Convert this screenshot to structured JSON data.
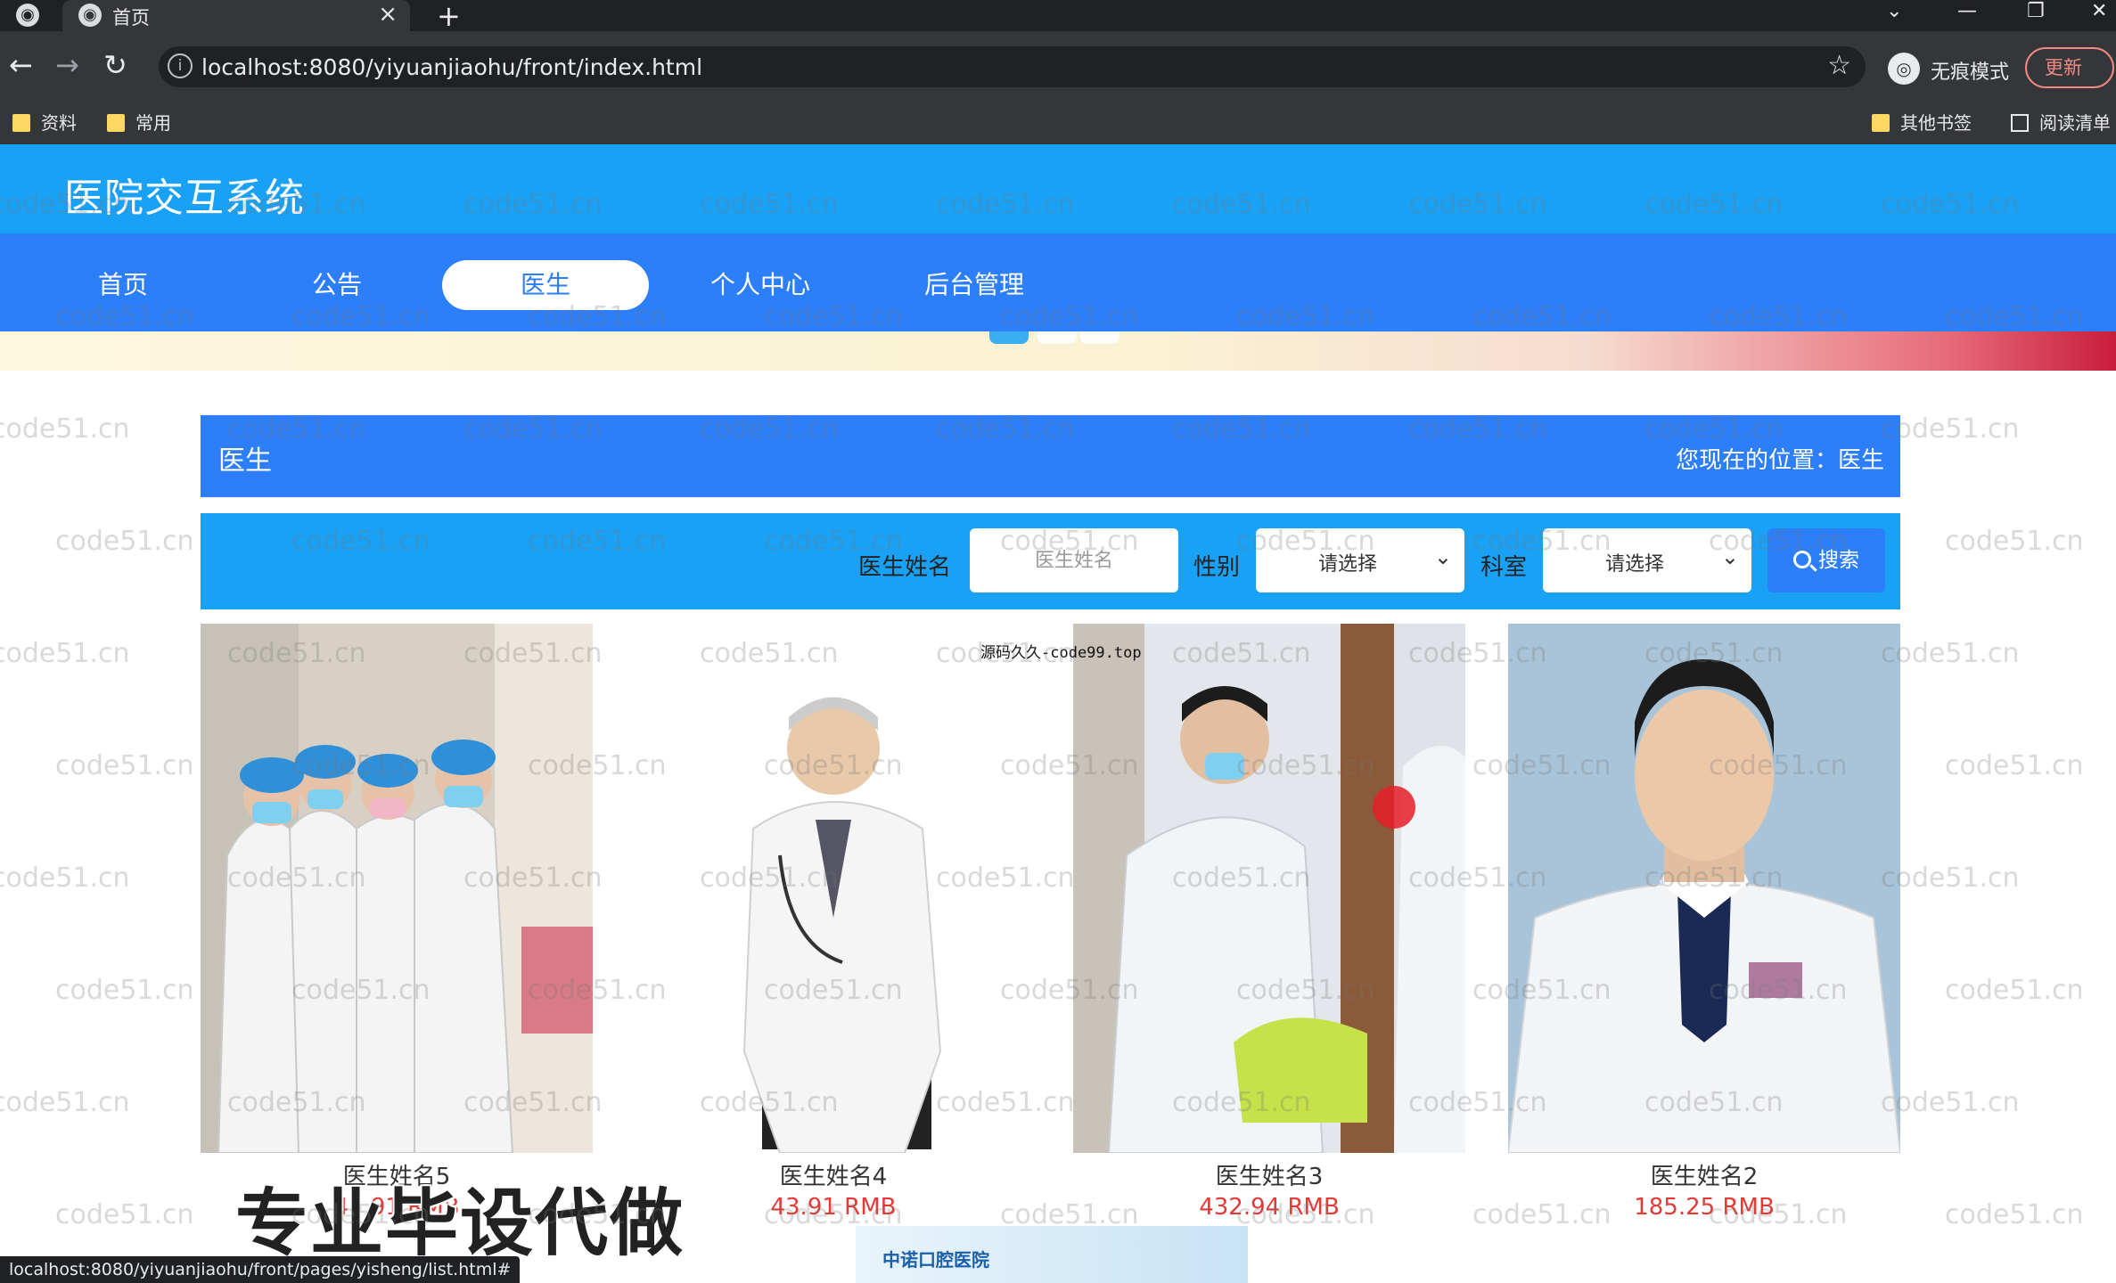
{
  "browser": {
    "tab_title": "首页",
    "tab_close": "×",
    "new_tab": "+",
    "url": "localhost:8080/yiyuanjiaohu/front/index.html",
    "incognito_label": "无痕模式",
    "update_label": "更新",
    "bookmarks": [
      "资料",
      "常用"
    ],
    "other_bookmarks": "其他书签",
    "reading_list": "阅读清单",
    "status_url": "localhost:8080/yiyuanjiaohu/front/pages/yisheng/list.html#"
  },
  "site": {
    "title": "医院交互系统",
    "nav": [
      "首页",
      "公告",
      "医生",
      "个人中心",
      "后台管理"
    ],
    "active_nav": "医生"
  },
  "breadcrumb": {
    "title": "医生",
    "location": "您现在的位置：医生"
  },
  "search": {
    "name_label": "医生姓名",
    "name_placeholder": "医生姓名",
    "gender_label": "性别",
    "gender_value": "请选择",
    "dept_label": "科室",
    "dept_value": "请选择",
    "button_label": "搜索"
  },
  "doctors": [
    {
      "name": "医生姓名5",
      "price": "43.91 RMB"
    },
    {
      "name": "医生姓名4",
      "price": "43.91 RMB"
    },
    {
      "name": "医生姓名3",
      "price": "432.94 RMB"
    },
    {
      "name": "医生姓名2",
      "price": "185.25 RMB"
    }
  ],
  "next_card_logo": "中诺口腔医院",
  "overlay": {
    "watermark_center": "源码久久-code99.top",
    "watermark_repeat": "code51.cn",
    "promo": "专业毕设代做"
  },
  "colors": {
    "header": "#19a1f6",
    "nav": "#2c7ef9",
    "price": "#e53935"
  }
}
